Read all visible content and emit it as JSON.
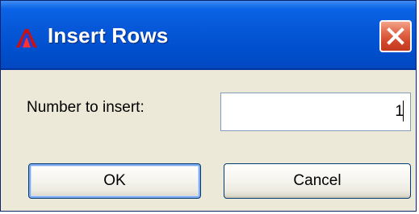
{
  "window": {
    "title": "Insert Rows",
    "app_icon": "app-logo-icon",
    "close_icon": "close-icon"
  },
  "form": {
    "label": "Number to insert:",
    "value": "1"
  },
  "buttons": {
    "ok": "OK",
    "cancel": "Cancel"
  },
  "colors": {
    "titlebar": "#0058d8",
    "close": "#d1462a",
    "dialog_bg": "#ece9d8"
  }
}
